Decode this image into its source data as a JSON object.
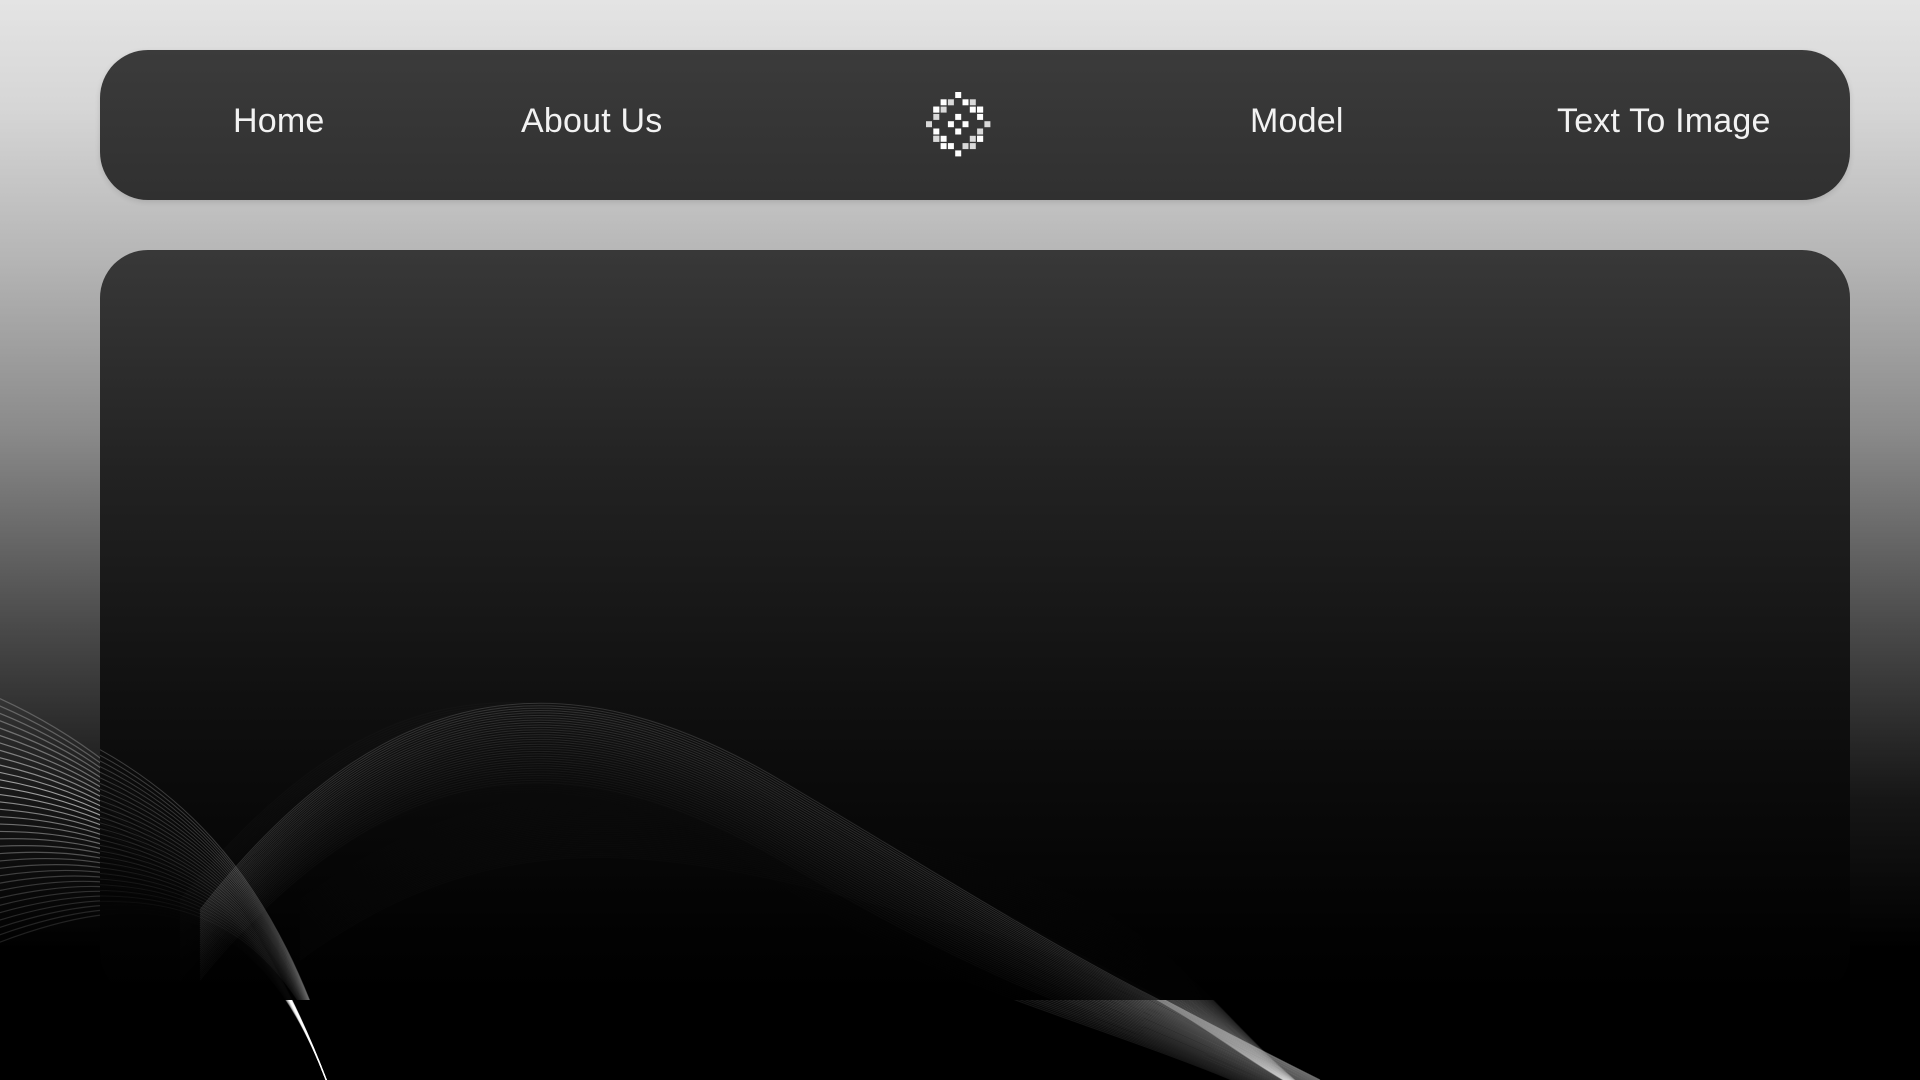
{
  "nav": {
    "items": [
      {
        "label": "Home"
      },
      {
        "label": "About Us"
      },
      {
        "label": "Model"
      },
      {
        "label": "Text To Image"
      }
    ],
    "logo_icon": "pixel-flower-logo-icon"
  },
  "colors": {
    "nav_background": "#353535",
    "panel_background": "#111111",
    "nav_text": "#f2f2f2",
    "wave_lines": "#ffffff"
  }
}
